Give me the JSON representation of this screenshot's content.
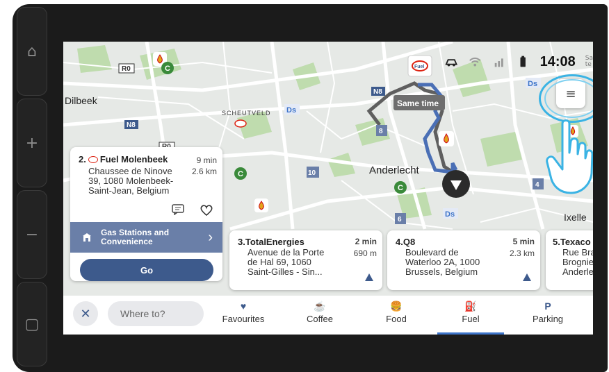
{
  "hardware": {
    "buttons": [
      {
        "name": "home-button",
        "glyph": "⌂"
      },
      {
        "name": "volume-up-button",
        "glyph": "+"
      },
      {
        "name": "volume-down-button",
        "glyph": "−"
      },
      {
        "name": "recent-apps-button",
        "glyph": "▢"
      }
    ]
  },
  "status": {
    "time": "14:08",
    "time_suffix": "Sa\nte"
  },
  "map": {
    "labels": {
      "dilbeek": "Dilbeek",
      "scheutveld": "SCHEUTVELD",
      "anderlecht": "Anderlecht",
      "ixelles": "Ixelle",
      "r0": "R0",
      "n8a": "N8",
      "n8b": "N8",
      "r0b": "R0",
      "route8": "8",
      "route10": "10",
      "route6": "6",
      "route4": "4",
      "ds1": "Ds",
      "ds2": "Ds",
      "ds3": "Ds",
      "fuel_pin": "Fuel"
    },
    "route_tooltip": "Same time"
  },
  "menu_icon": "≡",
  "cards": {
    "selected": {
      "index": "2.",
      "brand_glyph": "Fuel",
      "name": "Fuel Molenbeek",
      "duration": "9 min",
      "distance": "2.6 km",
      "address": "Chaussee de Ninove\n39, 1080 Molenbeek-\nSaint-Jean, Belgium",
      "category": "Gas Stations and Convenience",
      "go_label": "Go"
    },
    "list": [
      {
        "title": "3.TotalEnergies",
        "duration": "2 min",
        "distance": "690 m",
        "address": "Avenue de la Porte\nde Hal 69, 1060\nSaint-Gilles - Sin..."
      },
      {
        "title": "4.Q8",
        "duration": "5 min",
        "distance": "2.3 km",
        "address": "Boulevard de\nWaterloo 2A, 1000\nBrussels, Belgium"
      },
      {
        "title": "5.Texaco",
        "duration": "",
        "distance": "",
        "address": "Rue Bra\nBrogniez\nAnderle"
      }
    ]
  },
  "bottom": {
    "close": "✕",
    "search_placeholder": "Where to?",
    "categories": [
      {
        "label": "Favourites",
        "icon": "heart-icon",
        "glyph": "♥"
      },
      {
        "label": "Coffee",
        "icon": "coffee-icon",
        "glyph": "☕"
      },
      {
        "label": "Food",
        "icon": "food-icon",
        "glyph": "🍔"
      },
      {
        "label": "Fuel",
        "icon": "fuel-icon",
        "glyph": "⛽"
      },
      {
        "label": "Parking",
        "icon": "parking-icon",
        "glyph": "P"
      }
    ]
  },
  "colors": {
    "accent": "#3d5a8c",
    "highlight_ring": "#3ab3e4",
    "route": "#4a6fb5",
    "route_alt": "#666666"
  }
}
